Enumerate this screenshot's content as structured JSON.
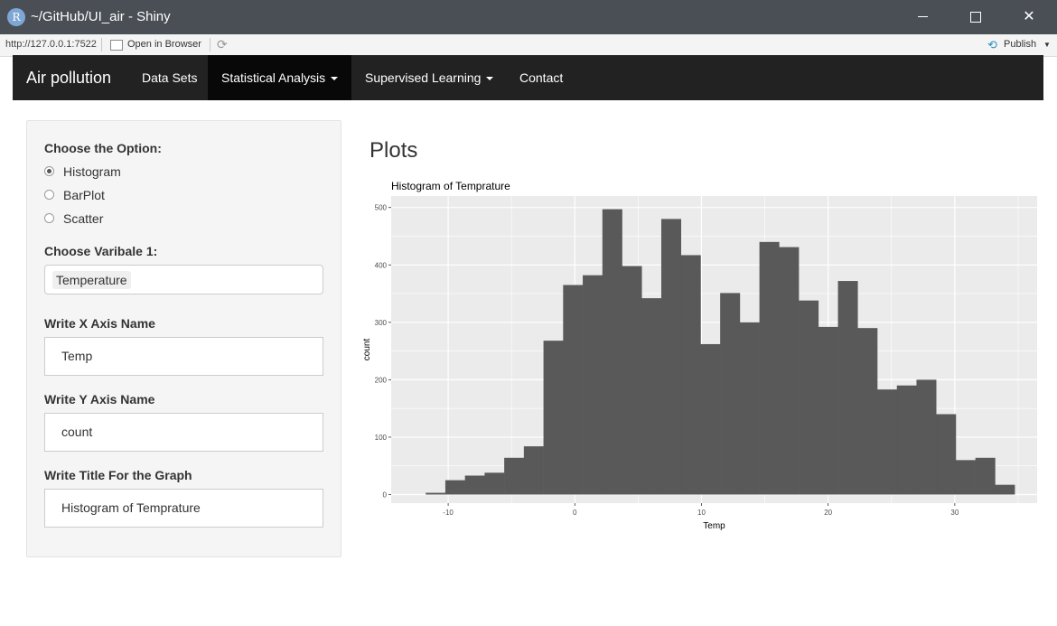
{
  "window": {
    "title": "~/GitHub/UI_air - Shiny",
    "app_icon_letter": "R"
  },
  "toolbar": {
    "url": "http://127.0.0.1:7522",
    "open_browser": "Open in Browser",
    "publish": "Publish"
  },
  "navbar": {
    "brand": "Air pollution",
    "items": [
      {
        "label": "Data Sets"
      },
      {
        "label": "Statistical Analysis"
      },
      {
        "label": "Supervised Learning"
      },
      {
        "label": "Contact"
      }
    ]
  },
  "sidebar": {
    "option_label": "Choose the Option:",
    "options": [
      "Histogram",
      "BarPlot",
      "Scatter"
    ],
    "selected_option": "Histogram",
    "var_label": "Choose Varibale 1:",
    "var_value": "Temperature",
    "xaxis_label": "Write X Axis Name",
    "xaxis_value": "Temp",
    "yaxis_label": "Write Y Axis Name",
    "yaxis_value": "count",
    "title_label": "Write Title For the Graph",
    "title_value": "Histogram of Temprature"
  },
  "main": {
    "heading": "Plots"
  },
  "chart_data": {
    "type": "bar",
    "title": "Histogram of Temprature",
    "xlabel": "Temp",
    "ylabel": "count",
    "xlim": [
      -14.5,
      36.5
    ],
    "ylim": [
      -15,
      520
    ],
    "x_ticks": [
      -10,
      0,
      10,
      20,
      30
    ],
    "y_ticks": [
      0,
      100,
      200,
      300,
      400,
      500
    ],
    "bin_width": 1.55,
    "bin_centers": [
      -11.0,
      -9.45,
      -7.9,
      -6.35,
      -4.8,
      -3.25,
      -1.7,
      -0.15,
      1.4,
      2.95,
      4.5,
      6.05,
      7.6,
      9.15,
      10.7,
      12.25,
      13.8,
      15.35,
      16.9,
      18.45,
      20.0,
      21.55,
      23.1,
      24.65,
      26.2,
      27.75,
      29.3,
      30.85,
      32.4,
      33.95
    ],
    "values": [
      3,
      25,
      33,
      38,
      64,
      84,
      268,
      365,
      382,
      497,
      398,
      342,
      480,
      417,
      262,
      351,
      300,
      440,
      431,
      338,
      292,
      372,
      290,
      183,
      190,
      200,
      140,
      60,
      64,
      17
    ],
    "colors": {
      "panel": "#ebebeb",
      "bar": "#595959",
      "grid": "#ffffff"
    },
    "grid": true
  }
}
